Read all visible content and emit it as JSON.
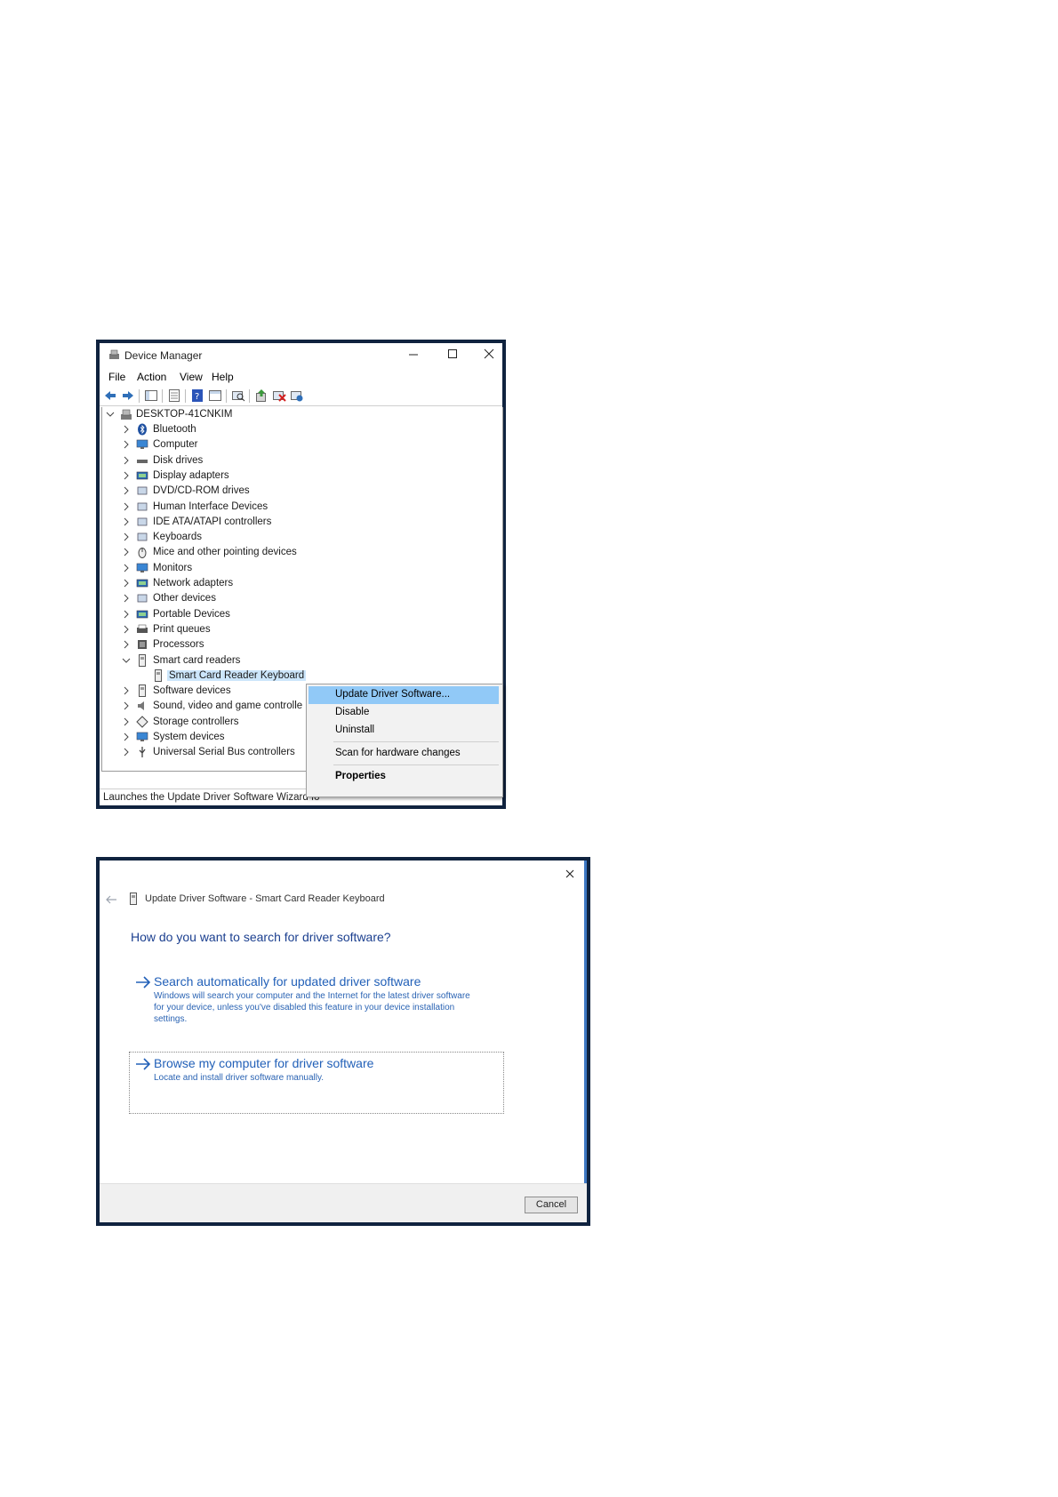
{
  "device_manager": {
    "title": "Device Manager",
    "menu": [
      "File",
      "Action",
      "View",
      "Help"
    ],
    "root": "DESKTOP-41CNKIM",
    "items": [
      {
        "label": "Bluetooth",
        "icon": "bluetooth-icon"
      },
      {
        "label": "Computer",
        "icon": "computer-icon"
      },
      {
        "label": "Disk drives",
        "icon": "disk-drive-icon"
      },
      {
        "label": "Display adapters",
        "icon": "display-adapter-icon"
      },
      {
        "label": "DVD/CD-ROM drives",
        "icon": "dvd-drive-icon"
      },
      {
        "label": "Human Interface Devices",
        "icon": "hid-icon"
      },
      {
        "label": "IDE ATA/ATAPI controllers",
        "icon": "ide-controller-icon"
      },
      {
        "label": "Keyboards",
        "icon": "keyboard-icon"
      },
      {
        "label": "Mice and other pointing devices",
        "icon": "mouse-icon"
      },
      {
        "label": "Monitors",
        "icon": "monitor-icon"
      },
      {
        "label": "Network adapters",
        "icon": "network-adapter-icon"
      },
      {
        "label": "Other devices",
        "icon": "other-device-icon"
      },
      {
        "label": "Portable Devices",
        "icon": "portable-device-icon"
      },
      {
        "label": "Print queues",
        "icon": "printer-icon"
      },
      {
        "label": "Processors",
        "icon": "processor-icon"
      },
      {
        "label": "Smart card readers",
        "icon": "smart-card-reader-icon"
      },
      {
        "label": "Smart Card Reader Keyboard",
        "icon": "smart-card-icon"
      },
      {
        "label": "Software devices",
        "icon": "software-device-icon"
      },
      {
        "label": "Sound, video and game controlle",
        "icon": "speaker-icon"
      },
      {
        "label": "Storage controllers",
        "icon": "storage-controller-icon"
      },
      {
        "label": "System devices",
        "icon": "system-device-icon"
      },
      {
        "label": "Universal Serial Bus controllers",
        "icon": "usb-icon"
      }
    ],
    "context_menu": [
      "Update Driver Software...",
      "Disable",
      "Uninstall",
      "Scan for hardware changes",
      "Properties"
    ],
    "status": "Launches the Update Driver Software Wizard fo"
  },
  "update_driver": {
    "title": "Update Driver Software - Smart Card Reader Keyboard",
    "question": "How do you want to search for driver software?",
    "option1_title": "Search automatically for updated driver software",
    "option1_desc_line1": "Windows will search your computer and the Internet for the latest driver software",
    "option1_desc_line2": "for your device, unless you've disabled this feature in your device installation",
    "option1_desc_line3": "settings.",
    "option2_title": "Browse my computer for driver software",
    "option2_desc": "Locate and install driver software manually.",
    "cancel_label": "Cancel"
  },
  "colors": {
    "highlight": "#91c9f7",
    "link": "#2260b8",
    "frame": "#10233f"
  }
}
